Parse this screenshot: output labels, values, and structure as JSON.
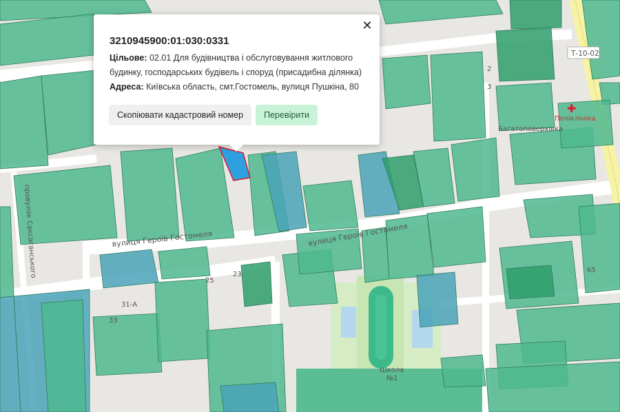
{
  "popup": {
    "cadastral_number": "3210945900:01:030:0331",
    "purpose_label": "Цільове:",
    "purpose_value": "02.01 Для будівництва і обслуговування житлового будинку, господарських будівель і споруд (присадибна ділянка)",
    "address_label": "Адреса:",
    "address_value": "Київська область, смт.Гостомель, вулиця Пушкіна, 80",
    "copy_button": "Скопіювати кадастровий номер",
    "check_button": "Перевірити",
    "close_symbol": "✕"
  },
  "map": {
    "streets": {
      "heroiv_west": "вулиця Героїв Гостомеля",
      "heroiv_east": "вулиця Героїв Гостомеля",
      "side_lane": "провулок Саксаганського",
      "road_code": "Т-10-02"
    },
    "pois": {
      "clinic": "Поліклініка",
      "multistorey": "Багатоповерхівка",
      "school_line1": "Школа",
      "school_line2": "№1"
    },
    "house_numbers": [
      "31-А",
      "33",
      "25",
      "23",
      "65",
      "2",
      "3"
    ],
    "colors": {
      "parcel": "#4fb98f",
      "parcel_dark": "#2f9e6c",
      "parcel_blue": "#4aa3b8",
      "selected": "#2ea0e0",
      "selected_border": "#e0192c",
      "road": "#ffffff",
      "main_road": "#f6f3a6",
      "background": "#e9e7e3"
    }
  }
}
